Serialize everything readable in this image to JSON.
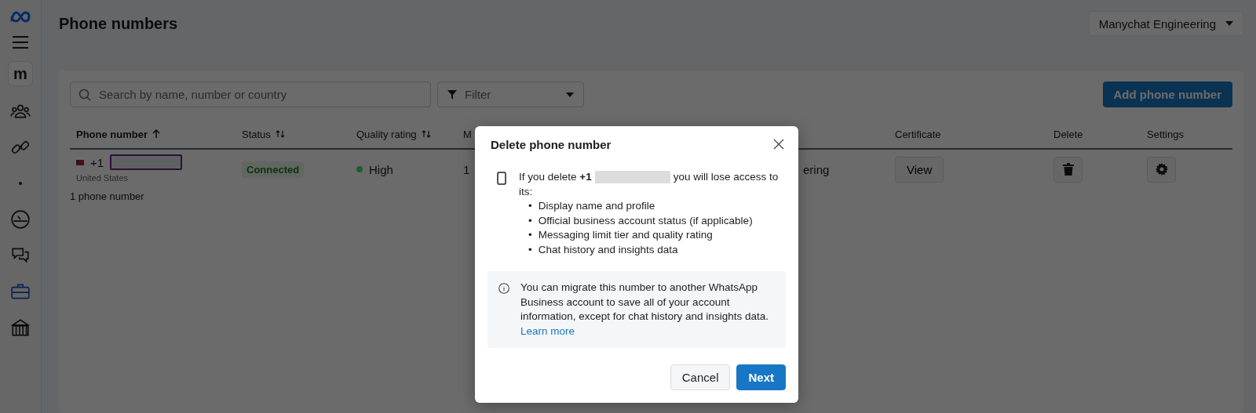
{
  "sidebar": {
    "workspace_logo": "m",
    "items": [
      {
        "kind": "people",
        "selected": false
      },
      {
        "kind": "link",
        "selected": false
      },
      {
        "kind": "dot",
        "selected": false
      },
      {
        "kind": "gauge",
        "selected": false
      },
      {
        "kind": "chat",
        "selected": false
      },
      {
        "kind": "briefcase",
        "selected": true
      },
      {
        "kind": "bank",
        "selected": false
      }
    ]
  },
  "page": {
    "title": "Phone numbers",
    "account": "Manychat Engineering"
  },
  "toolbar": {
    "search": {
      "placeholder": "Search by name, number or country"
    },
    "filter": {
      "label": "Filter"
    },
    "add_button": "Add phone number"
  },
  "table": {
    "columns": [
      {
        "label": "Phone number",
        "sortable": true,
        "sorted": true
      },
      {
        "label": "Status",
        "sortable": true,
        "sorted": false
      },
      {
        "label": "Quality rating",
        "sortable": true,
        "sorted": false
      },
      {
        "label": "M",
        "sortable": false,
        "sorted": false
      },
      {
        "label": "Certificate",
        "sortable": false,
        "sorted": false
      },
      {
        "label": "Delete",
        "sortable": false,
        "sorted": false
      },
      {
        "label": "Settings",
        "sortable": false,
        "sorted": false
      }
    ],
    "rows": [
      {
        "country_code": "+1",
        "country": "United States",
        "status": "Connected",
        "quality": "High",
        "color": "#1e5e2c",
        "column_4": "1",
        "column_5": "ering",
        "certificate": "View"
      }
    ],
    "count": "1 phone number"
  },
  "dialog": {
    "title": "Delete phone number",
    "intro_before": "If you delete **+1**",
    "intro_after": "you will lose access to",
    "intro_end": "its:",
    "bullet": "•",
    "items": [
      "Display name and profile",
      "Official business account status (if applicable)",
      "Messaging limit tier and quality rating",
      "Chat history and insights data"
    ],
    "notice": "You can migrate this number to another WhatsApp Business account to save all of your account information, except for chat history and insights data.",
    "notice_link": "Learn more",
    "buttons": [
      {
        "label": "Cancel",
        "kind": "secondary"
      },
      {
        "label": "Next",
        "kind": "primary"
      }
    ]
  }
}
